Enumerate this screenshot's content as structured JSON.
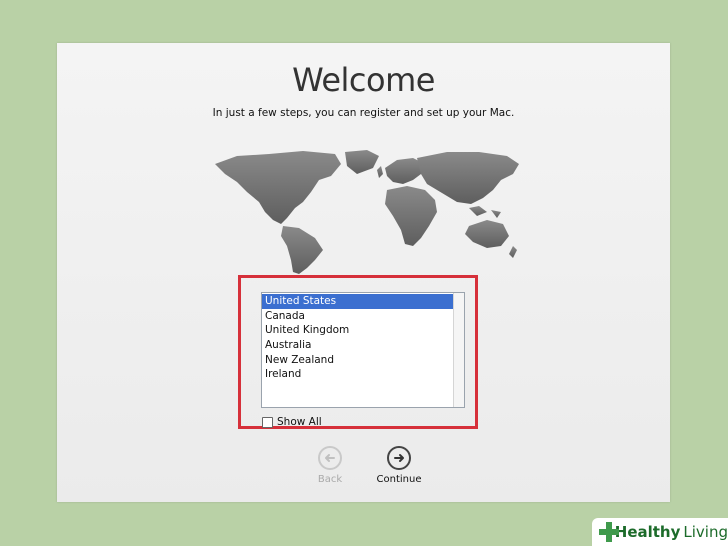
{
  "window": {
    "title": "Welcome",
    "subtitle": "In just a few steps, you can register and set up your Mac."
  },
  "country_list": {
    "items": [
      "United States",
      "Canada",
      "United Kingdom",
      "Australia",
      "New Zealand",
      "Ireland"
    ],
    "selected_index": 0
  },
  "show_all": {
    "label": "Show All",
    "checked": false
  },
  "buttons": {
    "back_label": "Back",
    "continue_label": "Continue"
  },
  "watermark": {
    "brand_bold": "Healthy",
    "brand_light": "Living"
  },
  "colors": {
    "background": "#b9d1a6",
    "highlight_border": "#d6303a",
    "selection": "#3b6fd0",
    "brand_green": "#3f9a4c"
  }
}
